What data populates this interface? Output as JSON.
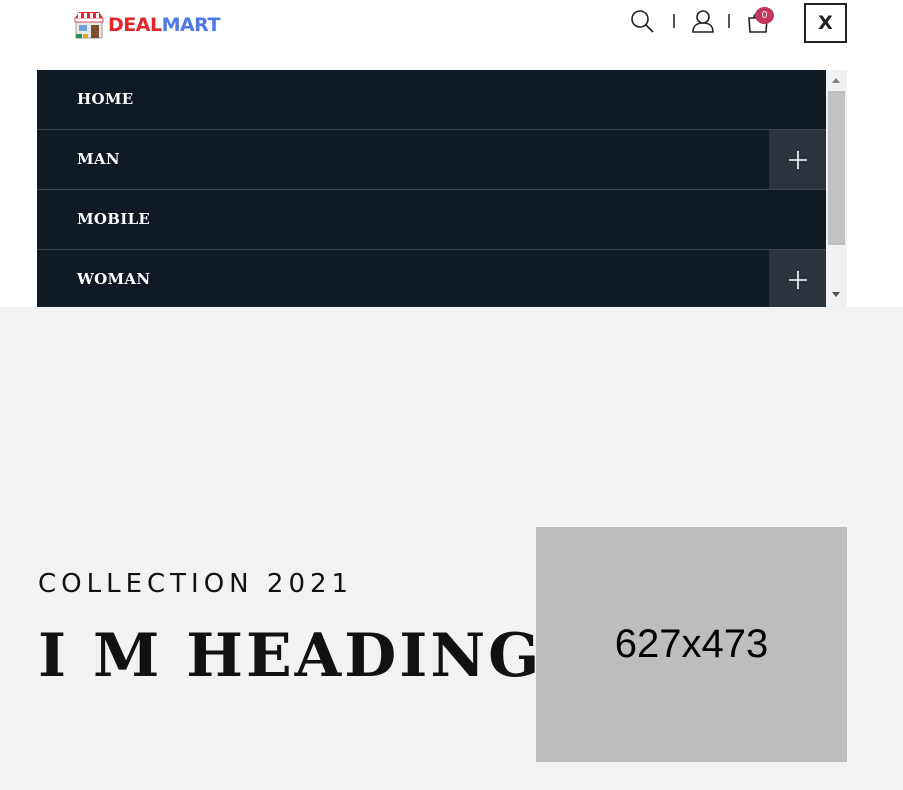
{
  "header": {
    "logo": {
      "part1": "DEAL",
      "part2": "MART"
    },
    "icons": [
      "search-icon",
      "user-icon",
      "cart-icon"
    ],
    "cart_count": "0",
    "close_label": "X"
  },
  "menu": {
    "items": [
      {
        "label": "HOME",
        "expandable": false
      },
      {
        "label": "MAN",
        "expandable": true
      },
      {
        "label": "MOBILE",
        "expandable": false
      },
      {
        "label": "WOMAN",
        "expandable": true
      }
    ],
    "expand_icon": "plus-icon"
  },
  "hero": {
    "subtitle": "COLLECTION 2021",
    "title": "I M HEADING",
    "image_placeholder": "627x473"
  },
  "colors": {
    "menu_bg": "#101a24",
    "plus_bg": "#2b333c",
    "badge": "#c2355d",
    "logo_deal": "#e3262b",
    "logo_mart": "#4f79e6",
    "hero_bg": "#f2f2f2",
    "placeholder_bg": "#bdbdbd"
  }
}
